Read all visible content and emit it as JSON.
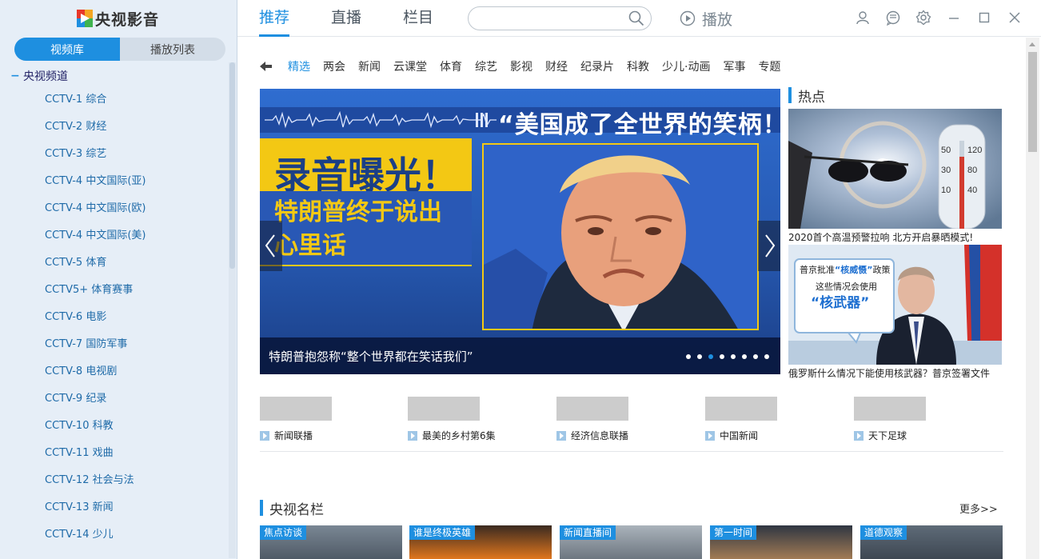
{
  "app": {
    "title": "央视影音"
  },
  "sidebar": {
    "tabs": [
      {
        "label": "视频库",
        "active": true
      },
      {
        "label": "播放列表",
        "active": false
      }
    ],
    "tree_root": "央视频道",
    "channels": [
      "CCTV-1 综合",
      "CCTV-2 财经",
      "CCTV-3 综艺",
      "CCTV-4 中文国际(亚)",
      "CCTV-4 中文国际(欧)",
      "CCTV-4 中文国际(美)",
      "CCTV-5 体育",
      "CCTV5+ 体育赛事",
      "CCTV-6 电影",
      "CCTV-7 国防军事",
      "CCTV-8 电视剧",
      "CCTV-9 纪录",
      "CCTV-10 科教",
      "CCTV-11 戏曲",
      "CCTV-12 社会与法",
      "CCTV-13 新闻",
      "CCTV-14 少儿"
    ]
  },
  "topbar": {
    "tabs": [
      {
        "label": "推荐",
        "active": true
      },
      {
        "label": "直播"
      },
      {
        "label": "栏目"
      }
    ],
    "search": {
      "value": "",
      "placeholder": ""
    },
    "play_label": "播放",
    "icons": [
      "user-icon",
      "feedback-icon",
      "settings-icon",
      "minimize-icon",
      "maximize-icon",
      "close-icon"
    ]
  },
  "categories": [
    "精选",
    "两会",
    "新闻",
    "云课堂",
    "体育",
    "综艺",
    "影视",
    "财经",
    "纪录片",
    "科教",
    "少儿·动画",
    "军事",
    "专题"
  ],
  "banner": {
    "quote": "“美国成了全世界的笑柄！”",
    "headline": "录音曝光！",
    "sub_lines": [
      "特朗普终于说出",
      "心里话"
    ],
    "caption": "特朗普抱怨称“整个世界都在笑话我们”",
    "slide_count": 8,
    "active_slide": 3
  },
  "hot": {
    "title": "热点",
    "items": [
      {
        "caption": "2020首个高温预警拉响 北方开启暴晒模式!"
      },
      {
        "caption": "俄罗斯什么情况下能使用核武器？普京签署文件",
        "overlay": {
          "line1": "普京批准",
          "highlight": "“核威慑”",
          "line1b": "政策",
          "line2": "这些情况会使用",
          "line3": "“核武器”"
        }
      }
    ]
  },
  "programs": [
    "新闻联播",
    "最美的乡村第6集",
    "经济信息联播",
    "中国新闻",
    "天下足球"
  ],
  "famous_columns": {
    "title": "央视名栏",
    "more": "更多>>",
    "cards": [
      "焦点访谈",
      "谁是终极英雄",
      "新闻直播间",
      "第一时间",
      "道德观察"
    ]
  },
  "colors": {
    "accent": "#1e8fe0",
    "sidebar_bg": "#e6eef7",
    "banner_yellow": "#f3c814",
    "banner_blue": "#2556ad"
  }
}
